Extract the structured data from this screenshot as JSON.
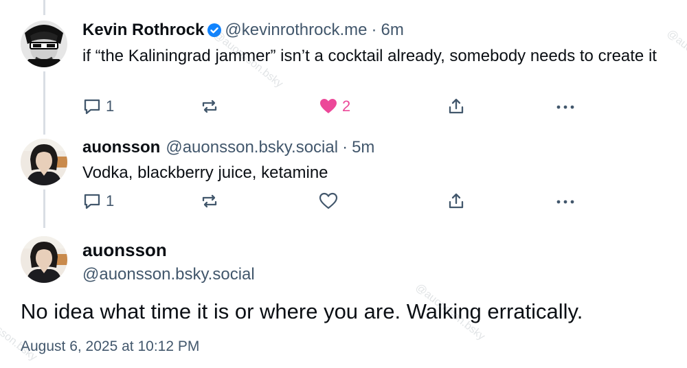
{
  "watermark": "@auonsson.bsky",
  "posts": [
    {
      "display_name": "Kevin Rothrock",
      "handle": "@kevinrothrock.me",
      "separator": "·",
      "time": "6m",
      "verified": true,
      "text": "if “the Kaliningrad jammer” isn’t a cocktail already, somebody needs to create it",
      "replies": "1",
      "likes": "2",
      "liked": true
    },
    {
      "display_name": "auonsson",
      "handle": "@auonsson.bsky.social",
      "separator": "·",
      "time": "5m",
      "text": "Vodka, blackberry juice, ketamine",
      "replies": "1"
    }
  ],
  "main_post": {
    "display_name": "auonsson",
    "handle": "@auonsson.bsky.social",
    "text": "No idea what time it is or where you are. Walking erratically.",
    "timestamp": "August 6, 2025 at 10:12 PM"
  },
  "colors": {
    "text": "#0b0f14",
    "muted": "#42576c",
    "like": "#ec4899",
    "verified": "#1083fe",
    "thread_line": "#d9dee4"
  }
}
